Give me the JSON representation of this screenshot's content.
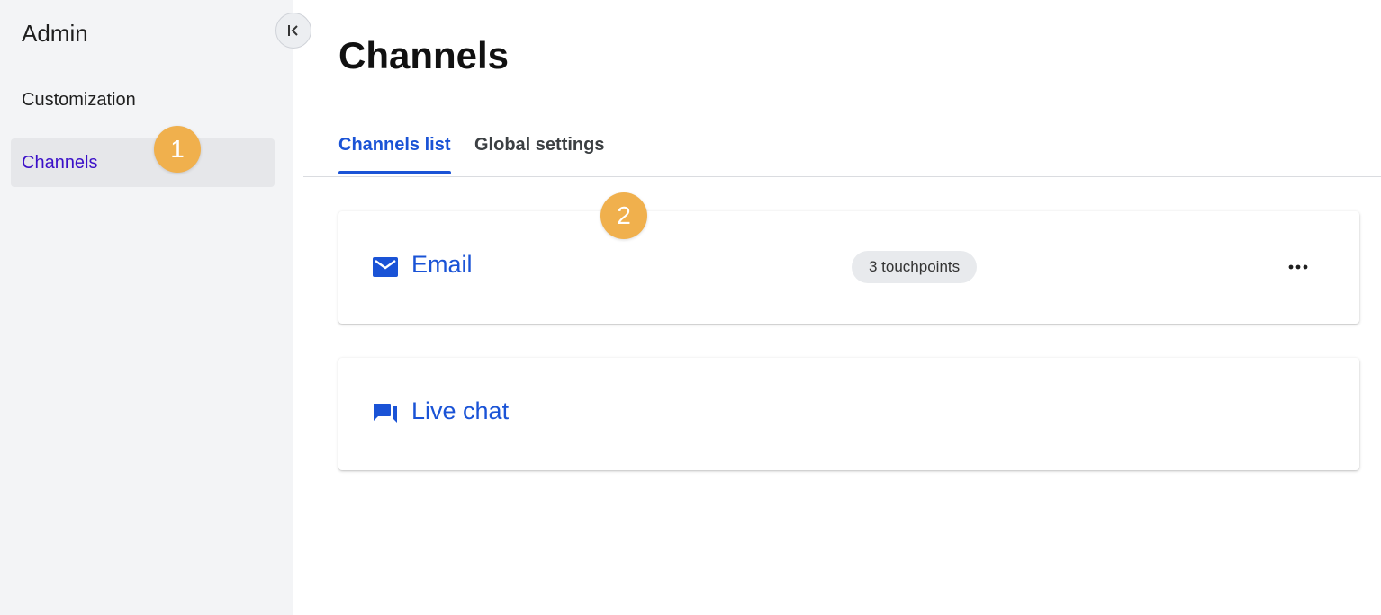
{
  "sidebar": {
    "title": "Admin",
    "items": [
      {
        "label": "Customization",
        "active": false
      },
      {
        "label": "Channels",
        "active": true
      }
    ]
  },
  "markers": {
    "one": "1",
    "two": "2"
  },
  "main": {
    "title": "Channels",
    "tabs": [
      {
        "label": "Channels list",
        "active": true
      },
      {
        "label": "Global settings",
        "active": false
      }
    ],
    "channels": [
      {
        "name": "Email",
        "icon": "email-icon",
        "touchpoints": "3 touchpoints"
      },
      {
        "name": "Live chat",
        "icon": "chat-icon"
      }
    ]
  },
  "colors": {
    "accent": "#1a53d6",
    "active_nav_text": "#3b10c8",
    "marker": "#f0b04d",
    "sidebar_bg": "#f3f4f6"
  }
}
